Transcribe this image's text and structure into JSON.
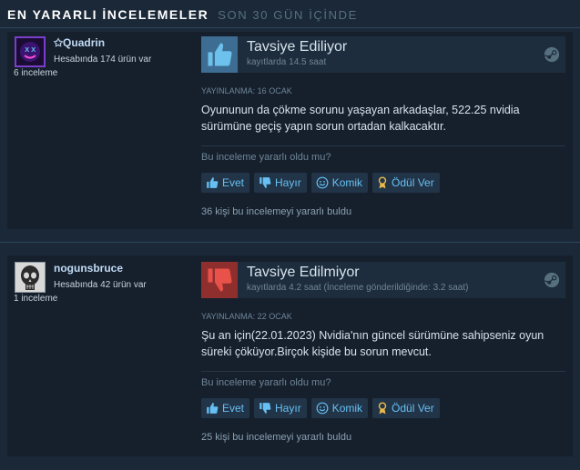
{
  "header": {
    "title": "EN YARARLI İNCELEMELER",
    "subtitle": "SON 30 GÜN İÇİNDE"
  },
  "reviews": [
    {
      "author": "✩Quadrin",
      "products_owned": "Hesabında 174 ürün var",
      "review_count": "6 inceleme",
      "verdict": "Tavsiye Ediliyor",
      "verdict_icon": "thumbs-up-icon",
      "hours": "kayıtlarda 14.5 saat",
      "posted": "YAYINLANMA: 16 OCAK",
      "text": "Oyununun da çökme sorunu yaşayan arkadaşlar, 522.25 nvidia sürümüne geçiş yapın sorun ortadan kalkacaktır.",
      "question": "Bu inceleme yararlı oldu mu?",
      "buttons": {
        "yes": "Evet",
        "no": "Hayır",
        "funny": "Komik",
        "award": "Ödül Ver"
      },
      "helpful": "36 kişi bu incelemeyi yararlı buldu"
    },
    {
      "author": "nogunsbruce",
      "products_owned": "Hesabında 42 ürün var",
      "review_count": "1 inceleme",
      "verdict": "Tavsiye Edilmiyor",
      "verdict_icon": "thumbs-down-icon",
      "hours": "kayıtlarda 4.2 saat (İnceleme gönderildiğinde: 3.2 saat)",
      "posted": "YAYINLANMA: 22 OCAK",
      "text": "Şu an için(22.01.2023) Nvidia'nın güncel sürümüne sahipseniz oyun süreki çöküyor.Birçok kişide bu sorun mevcut.",
      "question": "Bu inceleme yararlı oldu mu?",
      "buttons": {
        "yes": "Evet",
        "no": "Hayır",
        "funny": "Komik",
        "award": "Ödül Ver"
      },
      "helpful": "25 kişi bu incelemeyi yararlı buldu"
    }
  ],
  "colors": {
    "background": "#1b2838",
    "review_bg": "#16202d",
    "link_blue": "#66c0f4",
    "recommended": "#3e6d93",
    "not_recommended": "#8f2f2d"
  }
}
